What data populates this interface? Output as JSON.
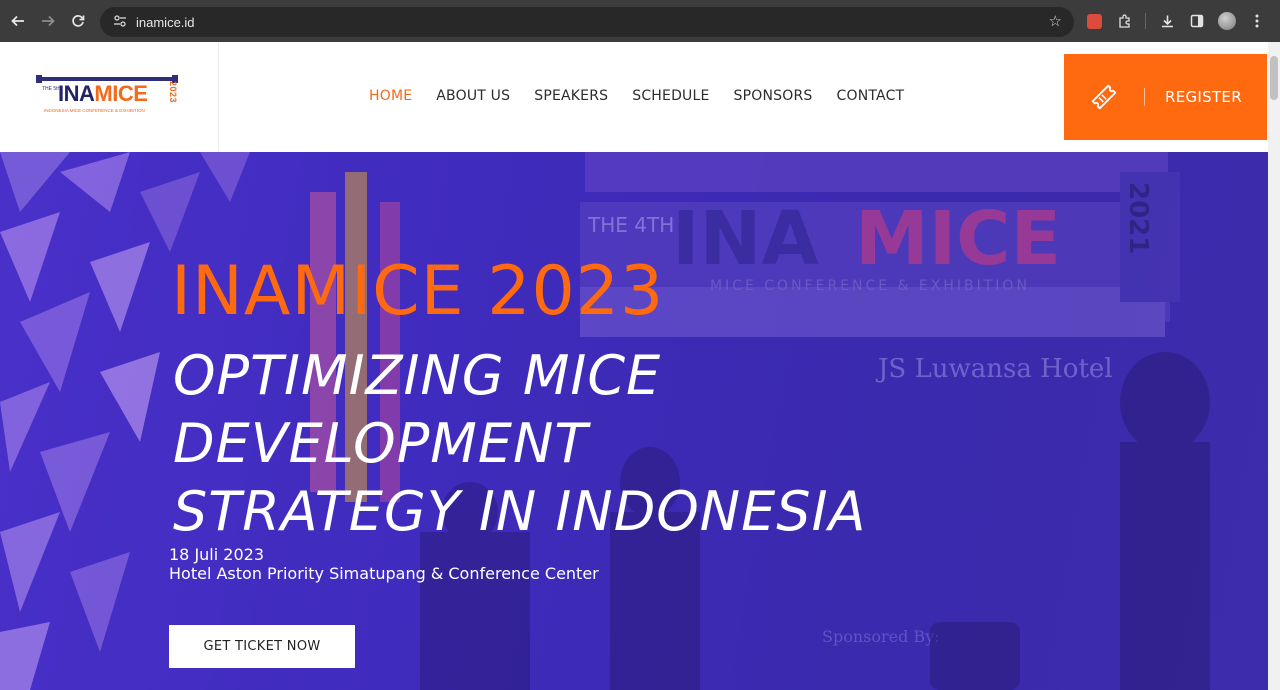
{
  "browser": {
    "url": "inamice.id",
    "icons": [
      "back-icon",
      "forward-icon",
      "reload-icon",
      "site-settings-icon",
      "bookmark-star-icon",
      "todoist-extension-icon",
      "extensions-icon",
      "download-icon",
      "side-panel-icon",
      "profile-avatar",
      "menu-icon"
    ]
  },
  "header": {
    "logo": {
      "small_prefix": "THE 5th",
      "word_ina": "INA",
      "word_mice": "MICE",
      "year": "2023",
      "tagline": "INDONESIA MICE CONFERENCE & EXHIBITION"
    },
    "nav": [
      {
        "label": "HOME",
        "active": true
      },
      {
        "label": "ABOUT US",
        "active": false
      },
      {
        "label": "SPEAKERS",
        "active": false
      },
      {
        "label": "SCHEDULE",
        "active": false
      },
      {
        "label": "SPONSORS",
        "active": false
      },
      {
        "label": "CONTACT",
        "active": false
      }
    ],
    "register_label": "REGISTER"
  },
  "hero": {
    "title": "INAMICE 2023",
    "subtitle_lines": [
      "OPTIMIZING MICE",
      "DEVELOPMENT",
      "STRATEGY IN INDONESIA"
    ],
    "date": "18 Juli 2023",
    "venue": "Hotel Aston Priority Simatupang & Conference Center",
    "cta_label": "GET TICKET NOW",
    "background_text": {
      "banner_the": "THE 4TH",
      "banner_ina": "INA",
      "banner_mice": "MICE",
      "banner_year": "2021",
      "banner_tagline": "MICE CONFERENCE & EXHIBITION",
      "hotel": "JS Luwansa Hotel",
      "sponsored_by": "Sponsored By:"
    }
  },
  "colors": {
    "accent": "#ff6a10",
    "hero_overlay": "#3f2bbd",
    "nav_text": "#2c2c2c",
    "logo_navy": "#23236b"
  }
}
